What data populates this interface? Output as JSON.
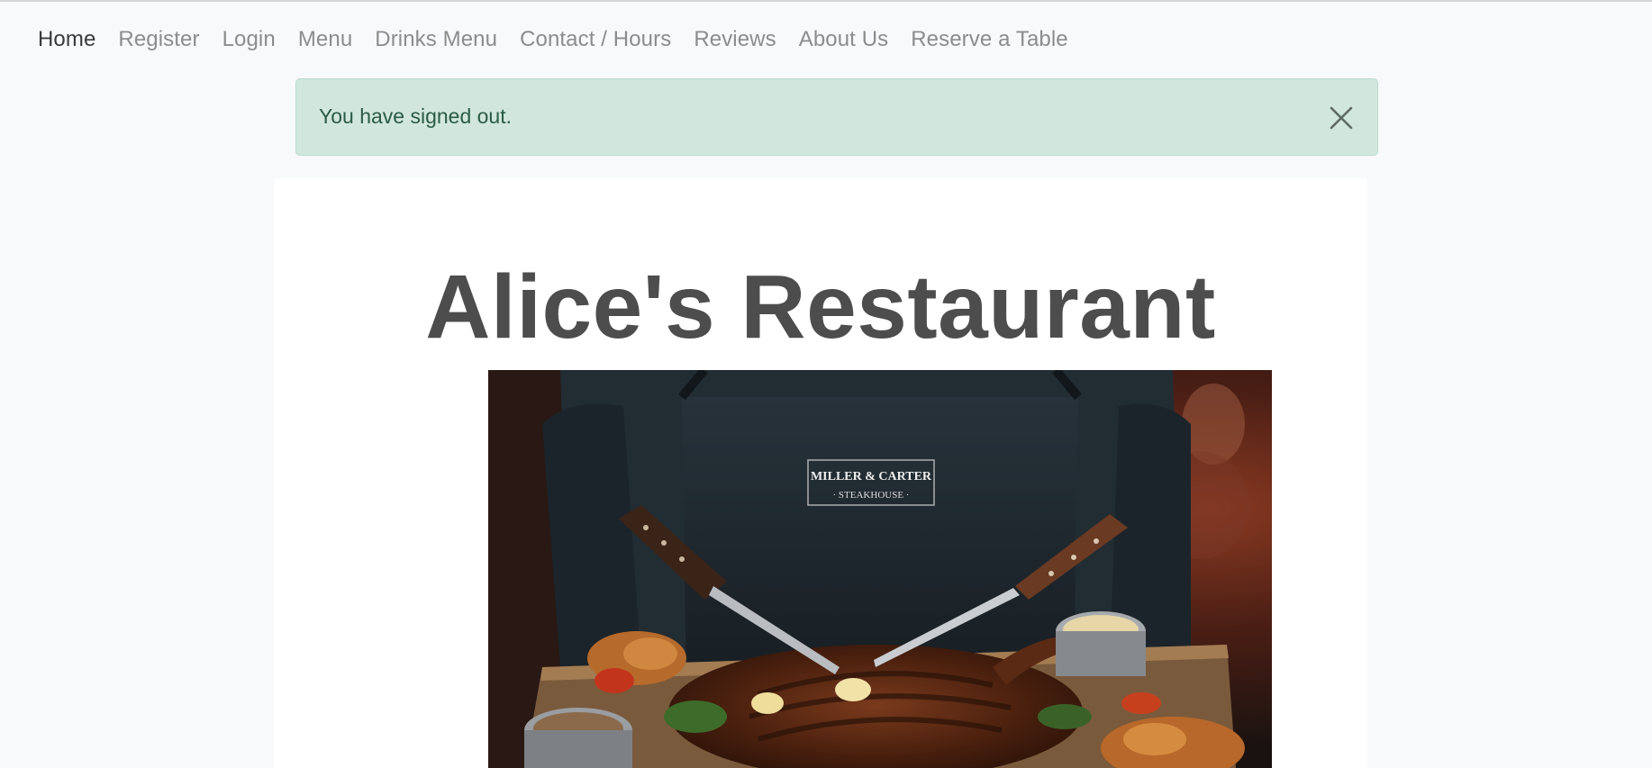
{
  "nav": {
    "items": [
      {
        "label": "Home",
        "active": true
      },
      {
        "label": "Register",
        "active": false
      },
      {
        "label": "Login",
        "active": false
      },
      {
        "label": "Menu",
        "active": false
      },
      {
        "label": "Drinks Menu",
        "active": false
      },
      {
        "label": "Contact / Hours",
        "active": false
      },
      {
        "label": "Reviews",
        "active": false
      },
      {
        "label": "About Us",
        "active": false
      },
      {
        "label": "Reserve a Table",
        "active": false
      }
    ]
  },
  "alert": {
    "message": "You have signed out.",
    "close_icon": "close-icon",
    "color": "#d1e7dd"
  },
  "hero": {
    "title": "Alice's Restaurant",
    "image_icon": "steak-photo",
    "apron_logo_line1": "MILLER & CARTER",
    "apron_logo_line2": "· STEAKHOUSE ·"
  }
}
